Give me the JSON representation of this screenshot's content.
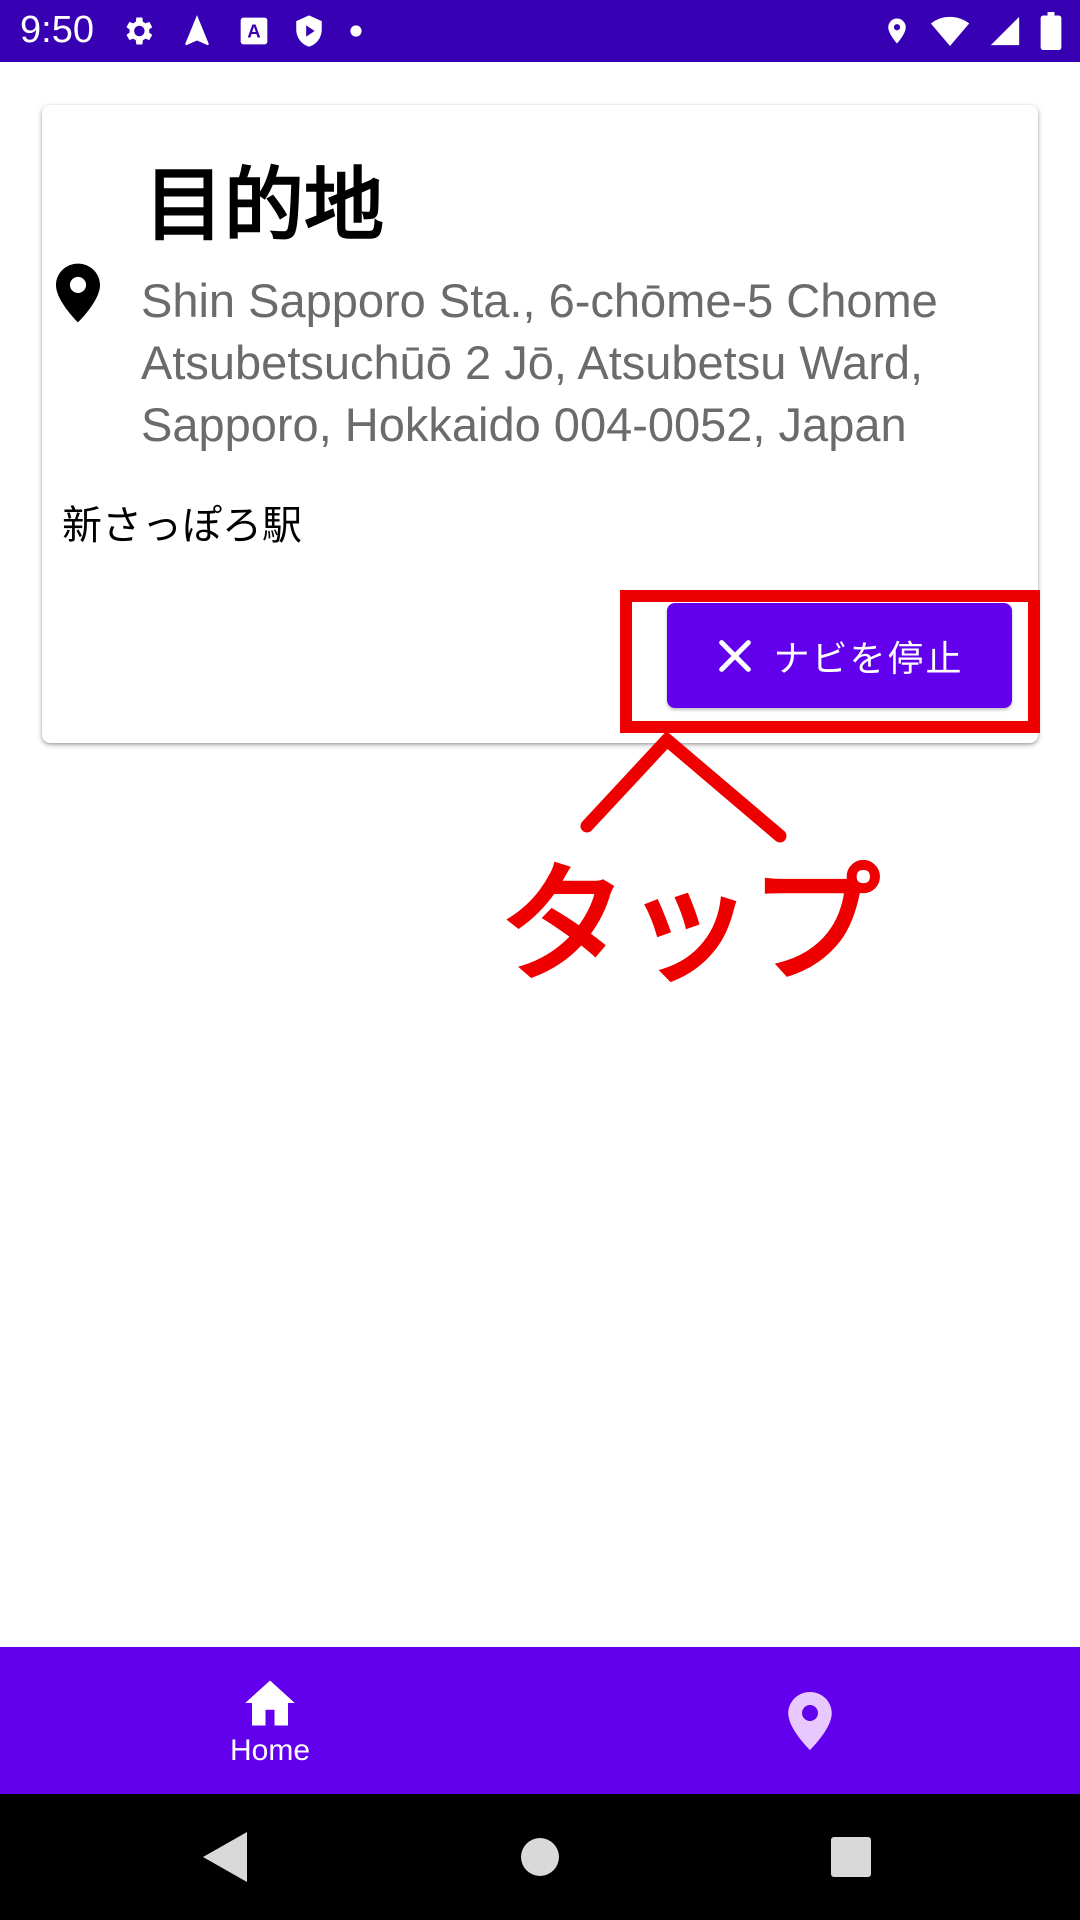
{
  "status_bar": {
    "time": "9:50",
    "left_icons": [
      "settings-icon",
      "navigation-arrow-icon",
      "text-icon",
      "shield-play-icon",
      "dot-icon"
    ],
    "right_icons": [
      "location-icon",
      "wifi-icon",
      "signal-icon",
      "battery-icon"
    ]
  },
  "card": {
    "title": "目的地",
    "address": "Shin Sapporo Sta., 6-chōme-5 Chome Atsubetsuchūō 2 Jō, Atsubetsu Ward, Sapporo, Hokkaido 004-0052, Japan",
    "station_name": "新さっぽろ駅",
    "stop_button_label": "ナビを停止"
  },
  "annotation": {
    "text": "タップ"
  },
  "bottom_nav": {
    "items": [
      {
        "label": "Home",
        "icon": "home-icon",
        "selected": true
      },
      {
        "label": "",
        "icon": "place-icon",
        "selected": false
      }
    ]
  },
  "system_nav": {
    "buttons": [
      "back-icon",
      "home-circle-icon",
      "recents-icon"
    ]
  },
  "colors": {
    "status_bar": "#3700b3",
    "primary": "#6200ee",
    "annotation": "#ee0000",
    "address_text": "#6b6b6b"
  }
}
